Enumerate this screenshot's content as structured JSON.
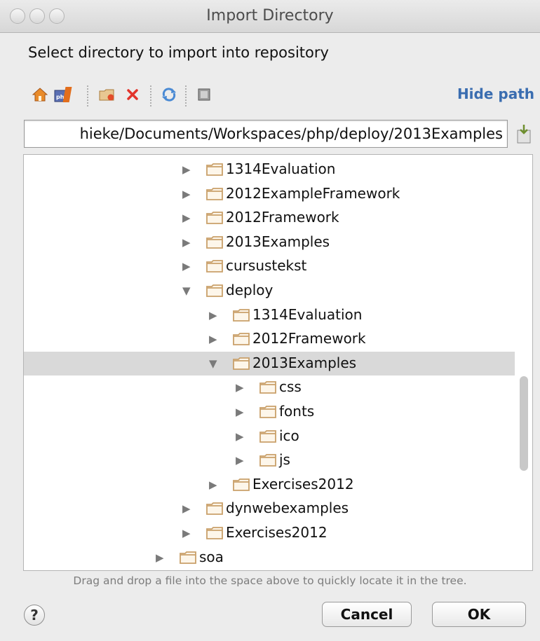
{
  "window": {
    "title": "Import Directory"
  },
  "dialog": {
    "subtitle": "Select directory to import into repository"
  },
  "toolbar": {
    "icons": [
      "home-icon",
      "php-project-icon",
      "new-folder-icon",
      "delete-icon",
      "refresh-icon",
      "show-hidden-icon"
    ],
    "hide_path_label": "Hide path"
  },
  "path": {
    "value": "hieke/Documents/Workspaces/php/deploy/2013Examples"
  },
  "tree": {
    "rows": [
      {
        "label": "1314Evaluation",
        "depth": 2,
        "expanded": false,
        "selected": false
      },
      {
        "label": "2012ExampleFramework",
        "depth": 2,
        "expanded": false,
        "selected": false
      },
      {
        "label": "2012Framework",
        "depth": 2,
        "expanded": false,
        "selected": false
      },
      {
        "label": "2013Examples",
        "depth": 2,
        "expanded": false,
        "selected": false
      },
      {
        "label": "cursustekst",
        "depth": 2,
        "expanded": false,
        "selected": false
      },
      {
        "label": "deploy",
        "depth": 2,
        "expanded": true,
        "selected": false
      },
      {
        "label": "1314Evaluation",
        "depth": 3,
        "expanded": false,
        "selected": false
      },
      {
        "label": "2012Framework",
        "depth": 3,
        "expanded": false,
        "selected": false
      },
      {
        "label": "2013Examples",
        "depth": 3,
        "expanded": true,
        "selected": true
      },
      {
        "label": "css",
        "depth": 4,
        "expanded": false,
        "selected": false
      },
      {
        "label": "fonts",
        "depth": 4,
        "expanded": false,
        "selected": false
      },
      {
        "label": "ico",
        "depth": 4,
        "expanded": false,
        "selected": false
      },
      {
        "label": "js",
        "depth": 4,
        "expanded": false,
        "selected": false
      },
      {
        "label": "Exercises2012",
        "depth": 3,
        "expanded": false,
        "selected": false
      },
      {
        "label": "dynwebexamples",
        "depth": 2,
        "expanded": false,
        "selected": false
      },
      {
        "label": "Exercises2012",
        "depth": 2,
        "expanded": false,
        "selected": false
      },
      {
        "label": "soa",
        "depth": 1,
        "expanded": false,
        "selected": false
      }
    ]
  },
  "hint": "Drag and drop a file into the space above to quickly locate it in the tree.",
  "buttons": {
    "help": "?",
    "cancel": "Cancel",
    "ok": "OK"
  },
  "colors": {
    "folder": "#c9a06a",
    "link": "#3a6db0",
    "selection": "#d9d9d9"
  }
}
